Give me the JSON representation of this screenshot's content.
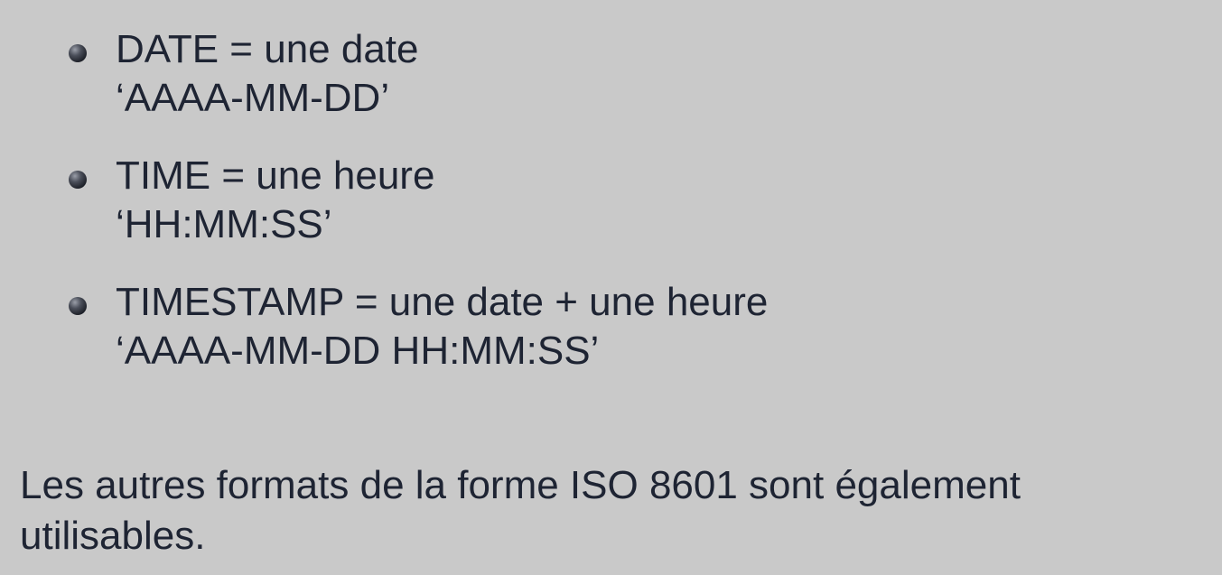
{
  "bullets": [
    {
      "line1": "DATE = une date",
      "line2": "‘AAAA-MM-DD’"
    },
    {
      "line1": "TIME = une heure",
      "line2": "‘HH:MM:SS’"
    },
    {
      "line1": "TIMESTAMP = une date + une heure",
      "line2": "‘AAAA-MM-DD HH:MM:SS’"
    }
  ],
  "paragraph": "Les autres formats de la forme ISO 8601 sont également utilisables.",
  "colors": {
    "background": "#c9c9c9",
    "text": "#1e2433"
  }
}
